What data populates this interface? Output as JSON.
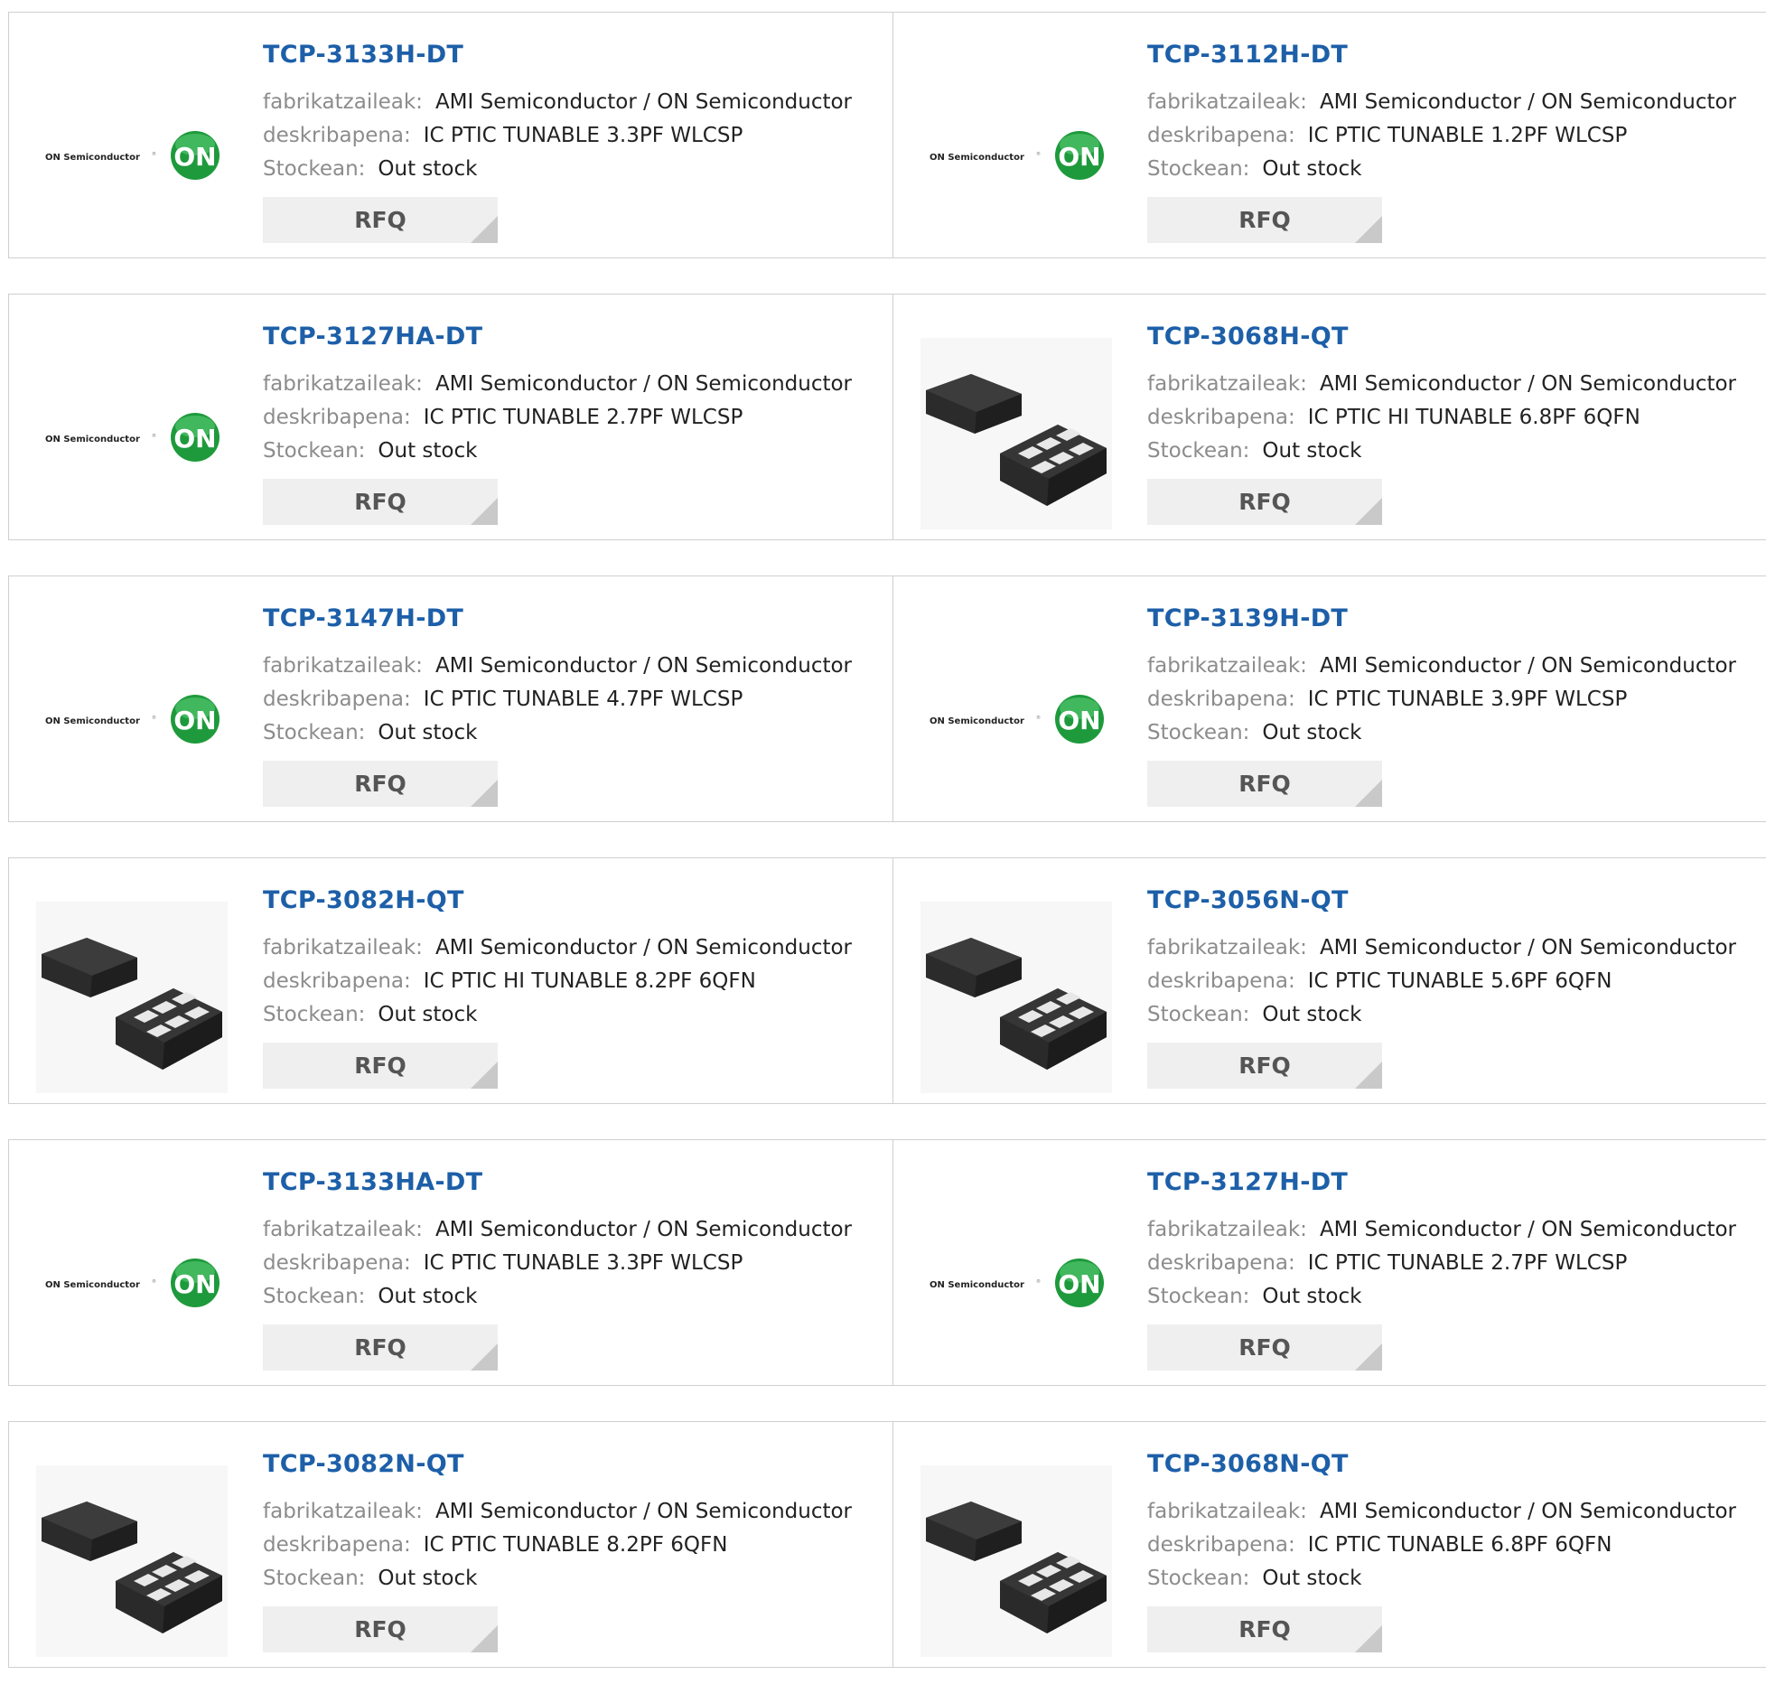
{
  "colors": {
    "part_link": "#1d5fa8",
    "label": "#8c8c8c",
    "value": "#222222",
    "rfq_bg": "#efefef",
    "border": "#cfcfcf",
    "on_logo_green": "#1e9a3c"
  },
  "labels": {
    "manufacturer": "fabrikatzaileak:",
    "description": "deskribapena:",
    "stock": "Stockean:",
    "rfq": "RFQ"
  },
  "logo_text": "ON Semiconductor",
  "products": [
    {
      "part": "TCP-3133H-DT",
      "manufacturer": "AMI Semiconductor / ON Semiconductor",
      "description": "IC PTIC TUNABLE 3.3PF WLCSP",
      "stock": "Out stock",
      "image": "on-semiconductor-logo"
    },
    {
      "part": "TCP-3112H-DT",
      "manufacturer": "AMI Semiconductor / ON Semiconductor",
      "description": "IC PTIC TUNABLE 1.2PF WLCSP",
      "stock": "Out stock",
      "image": "on-semiconductor-logo"
    },
    {
      "part": "TCP-3127HA-DT",
      "manufacturer": "AMI Semiconductor / ON Semiconductor",
      "description": "IC PTIC TUNABLE 2.7PF WLCSP",
      "stock": "Out stock",
      "image": "on-semiconductor-logo"
    },
    {
      "part": "TCP-3068H-QT",
      "manufacturer": "AMI Semiconductor / ON Semiconductor",
      "description": "IC PTIC HI TUNABLE 6.8PF 6QFN",
      "stock": "Out stock",
      "image": "qfn-chip-photo"
    },
    {
      "part": "TCP-3147H-DT",
      "manufacturer": "AMI Semiconductor / ON Semiconductor",
      "description": "IC PTIC TUNABLE 4.7PF WLCSP",
      "stock": "Out stock",
      "image": "on-semiconductor-logo"
    },
    {
      "part": "TCP-3139H-DT",
      "manufacturer": "AMI Semiconductor / ON Semiconductor",
      "description": "IC PTIC TUNABLE 3.9PF WLCSP",
      "stock": "Out stock",
      "image": "on-semiconductor-logo"
    },
    {
      "part": "TCP-3082H-QT",
      "manufacturer": "AMI Semiconductor / ON Semiconductor",
      "description": "IC PTIC HI TUNABLE 8.2PF 6QFN",
      "stock": "Out stock",
      "image": "qfn-chip-photo"
    },
    {
      "part": "TCP-3056N-QT",
      "manufacturer": "AMI Semiconductor / ON Semiconductor",
      "description": "IC PTIC TUNABLE 5.6PF 6QFN",
      "stock": "Out stock",
      "image": "qfn-chip-photo"
    },
    {
      "part": "TCP-3133HA-DT",
      "manufacturer": "AMI Semiconductor / ON Semiconductor",
      "description": "IC PTIC TUNABLE 3.3PF WLCSP",
      "stock": "Out stock",
      "image": "on-semiconductor-logo"
    },
    {
      "part": "TCP-3127H-DT",
      "manufacturer": "AMI Semiconductor / ON Semiconductor",
      "description": "IC PTIC TUNABLE 2.7PF WLCSP",
      "stock": "Out stock",
      "image": "on-semiconductor-logo"
    },
    {
      "part": "TCP-3082N-QT",
      "manufacturer": "AMI Semiconductor / ON Semiconductor",
      "description": "IC PTIC TUNABLE 8.2PF 6QFN",
      "stock": "Out stock",
      "image": "qfn-chip-photo"
    },
    {
      "part": "TCP-3068N-QT",
      "manufacturer": "AMI Semiconductor / ON Semiconductor",
      "description": "IC PTIC TUNABLE 6.8PF 6QFN",
      "stock": "Out stock",
      "image": "qfn-chip-photo"
    }
  ]
}
